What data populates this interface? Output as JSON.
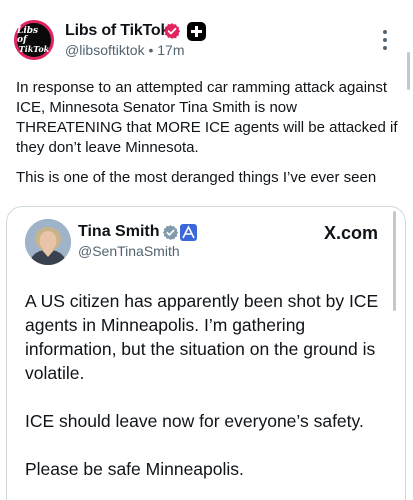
{
  "tweet": {
    "author_name": "Libs of TikTok",
    "handle": "@libsoftiktok",
    "separator": "•",
    "time": "17m",
    "avatar_text": [
      "Libs of",
      "TikTok"
    ],
    "paragraphs": [
      "In response to an attempted car ramming attack against ICE, Minnesota Senator Tina Smith is now THREATENING that MORE ICE agents will be attacked if they don’t leave Minnesota.",
      "This is one of the most deranged things I’ve ever seen"
    ],
    "icons": {
      "verified": "verified-badge-icon",
      "affiliate": "affiliate-plus-icon",
      "more": "more-vertical-icon"
    },
    "colors": {
      "verified": "#e0245e",
      "text": "#0f1419",
      "secondary": "#536471"
    }
  },
  "quoted": {
    "name": "Tina Smith",
    "handle": "@SenTinaSmith",
    "source": "X.com",
    "paragraphs": [
      "A US citizen has apparently been shot by ICE agents in Minneapolis. I’m gathering information, but the situation on the ground is volatile.",
      "ICE should leave now for everyone’s safety.",
      "Please be safe Minneapolis."
    ],
    "icons": {
      "verified": "gray-check-badge-icon",
      "government": "government-badge-icon"
    },
    "colors": {
      "gov_badge": "#3c67d8",
      "check": "#829aab"
    }
  }
}
